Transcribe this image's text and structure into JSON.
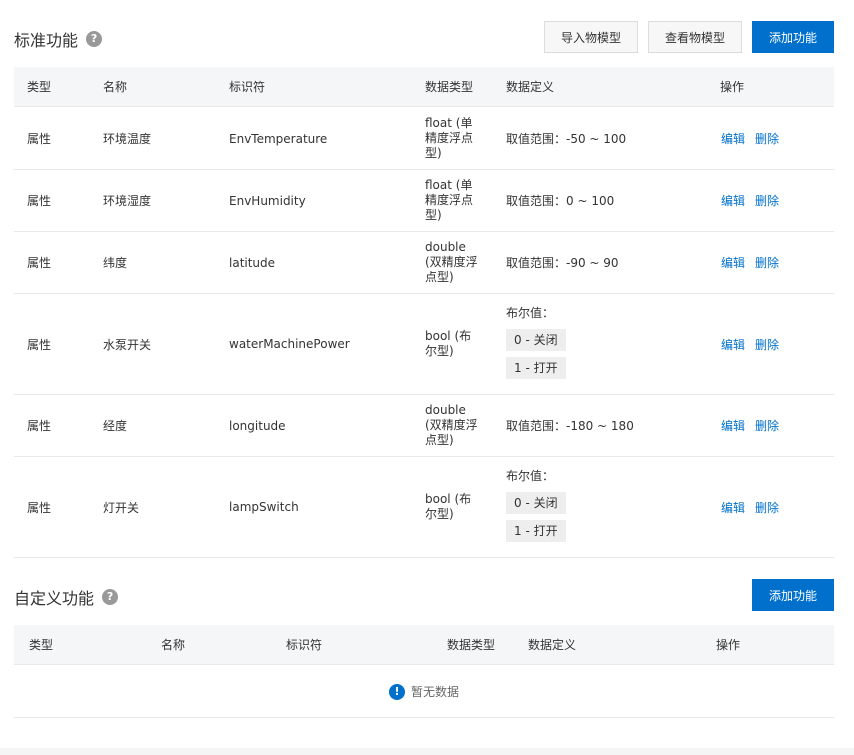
{
  "standard": {
    "title": "标准功能",
    "help_glyph": "?",
    "buttons": {
      "import": "导入物模型",
      "view": "查看物模型",
      "add": "添加功能"
    },
    "columns": [
      "类型",
      "名称",
      "标识符",
      "数据类型",
      "数据定义",
      "操作"
    ],
    "rows": [
      {
        "type": "属性",
        "name": "环境温度",
        "identifier": "EnvTemperature",
        "data_type": "float (单精度浮点型)",
        "definition": "取值范围：-50 ~ 100",
        "edit": "编辑",
        "delete": "删除"
      },
      {
        "type": "属性",
        "name": "环境湿度",
        "identifier": "EnvHumidity",
        "data_type": "float (单精度浮点型)",
        "definition": "取值范围：0 ~ 100",
        "edit": "编辑",
        "delete": "删除"
      },
      {
        "type": "属性",
        "name": "纬度",
        "identifier": "latitude",
        "data_type": "double (双精度浮点型)",
        "definition": "取值范围：-90 ~ 90",
        "edit": "编辑",
        "delete": "删除"
      },
      {
        "type": "属性",
        "name": "水泵开关",
        "identifier": "waterMachinePower",
        "data_type": "bool (布尔型)",
        "bool_title": "布尔值：",
        "bool_values": [
          "0 - 关闭",
          "1 - 打开"
        ],
        "edit": "编辑",
        "delete": "删除"
      },
      {
        "type": "属性",
        "name": "经度",
        "identifier": "longitude",
        "data_type": "double (双精度浮点型)",
        "definition": "取值范围：-180 ~ 180",
        "edit": "编辑",
        "delete": "删除"
      },
      {
        "type": "属性",
        "name": "灯开关",
        "identifier": "lampSwitch",
        "data_type": "bool (布尔型)",
        "bool_title": "布尔值：",
        "bool_values": [
          "0 - 关闭",
          "1 - 打开"
        ],
        "edit": "编辑",
        "delete": "删除"
      }
    ]
  },
  "custom": {
    "title": "自定义功能",
    "help_glyph": "?",
    "buttons": {
      "add": "添加功能"
    },
    "columns": [
      "类型",
      "名称",
      "标识符",
      "数据类型",
      "数据定义",
      "操作"
    ],
    "empty_icon": "!",
    "empty_text": "暂无数据"
  },
  "colors": {
    "primary": "#0070cc",
    "header_bg": "#f5f6f7",
    "border": "#e8e8e8"
  }
}
